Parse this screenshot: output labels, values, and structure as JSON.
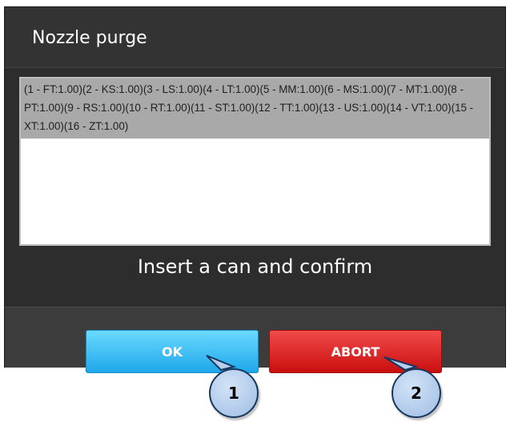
{
  "dialog": {
    "title": "Nozzle purge",
    "nozzle_list": "(1 - FT:1.00)(2 - KS:1.00)(3 - LS:1.00)(4 - LT:1.00)(5 - MM:1.00)(6 - MS:1.00)(7 - MT:1.00)(8 - PT:1.00)(9 - RS:1.00)(10 - RT:1.00)(11 - ST:1.00)(12 - TT:1.00)(13 - US:1.00)(14 - VT:1.00)(15 - XT:1.00)(16 - ZT:1.00)",
    "prompt": "Insert a can and confirm"
  },
  "buttons": {
    "ok_label": "OK",
    "abort_label": "ABORT"
  },
  "callouts": {
    "first": "1",
    "second": "2"
  },
  "colors": {
    "dialog_bg": "#2d2d2d",
    "ok_accent": "#1ea8ea",
    "abort_accent": "#c90f0f",
    "callout_fill": "#b8cfee",
    "callout_border": "#17375e"
  }
}
